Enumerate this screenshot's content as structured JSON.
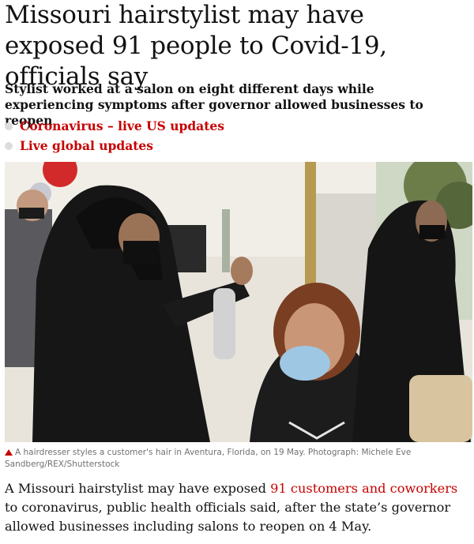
{
  "article": {
    "headline": "Missouri hairstylist may have exposed 91 people to Covid-19, officials say",
    "standfirst": "Stylist worked at a salon on eight different days while experiencing symptoms after governor allowed businesses to reopen",
    "related_links": [
      {
        "label": "Coronavirus – live US updates"
      },
      {
        "label": "Live global updates"
      }
    ],
    "photo": {
      "caption": "A hairdresser styles a customer's hair in Aventura, Florida, on 19 May. Photograph: Michele Eve Sandberg/REX/Shutterstock"
    },
    "body": {
      "before_link": "A Missouri hairstylist may have exposed ",
      "link_text": "91 customers and coworkers",
      "after_link": " to coronavirus, public health officials said, after the state’s governor allowed businesses including salons to reopen on 4 May."
    }
  },
  "colors": {
    "accent": "#c70000",
    "text": "#121212",
    "caption": "#707070",
    "bullet": "#dcdcdc"
  }
}
